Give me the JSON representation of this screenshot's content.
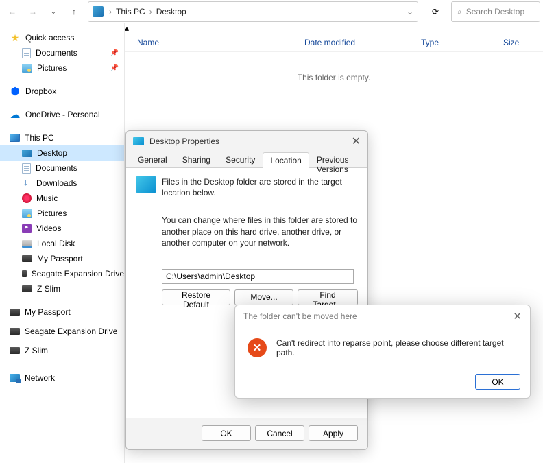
{
  "toolbar": {
    "breadcrumb": [
      "This PC",
      "Desktop"
    ],
    "search_placeholder": "Search Desktop"
  },
  "sidebar": {
    "quick_access": "Quick access",
    "qa_items": [
      {
        "label": "Documents",
        "pinned": true
      },
      {
        "label": "Pictures",
        "pinned": true
      }
    ],
    "dropbox": "Dropbox",
    "onedrive": "OneDrive - Personal",
    "this_pc": "This PC",
    "pc_items": [
      {
        "label": "Desktop",
        "icon": "desktop",
        "selected": true
      },
      {
        "label": "Documents",
        "icon": "doc"
      },
      {
        "label": "Downloads",
        "icon": "download"
      },
      {
        "label": "Music",
        "icon": "music"
      },
      {
        "label": "Pictures",
        "icon": "pic"
      },
      {
        "label": "Videos",
        "icon": "video"
      },
      {
        "label": "Local Disk",
        "icon": "disk"
      },
      {
        "label": "My Passport",
        "icon": "drive"
      },
      {
        "label": "Seagate Expansion Drive",
        "icon": "drive"
      },
      {
        "label": "Z Slim",
        "icon": "drive"
      }
    ],
    "root_drives": [
      {
        "label": "My Passport"
      },
      {
        "label": "Seagate Expansion Drive"
      },
      {
        "label": "Z Slim"
      }
    ],
    "network": "Network"
  },
  "columns": {
    "name": "Name",
    "date": "Date modified",
    "type": "Type",
    "size": "Size"
  },
  "empty": "This folder is empty.",
  "props": {
    "title": "Desktop Properties",
    "tabs": [
      "General",
      "Sharing",
      "Security",
      "Location",
      "Previous Versions"
    ],
    "active_tab": 3,
    "line1": "Files in the Desktop folder are stored in the target location below.",
    "line2": "You can change where files in this folder are stored to another place on this hard drive, another drive, or another computer on your network.",
    "path": "C:\\Users\\admin\\Desktop",
    "restore": "Restore Default",
    "move": "Move...",
    "find": "Find Target...",
    "ok": "OK",
    "cancel": "Cancel",
    "apply": "Apply"
  },
  "error": {
    "title": "The folder can't be moved here",
    "message": "Can't redirect into reparse point, please choose different target path.",
    "ok": "OK"
  }
}
